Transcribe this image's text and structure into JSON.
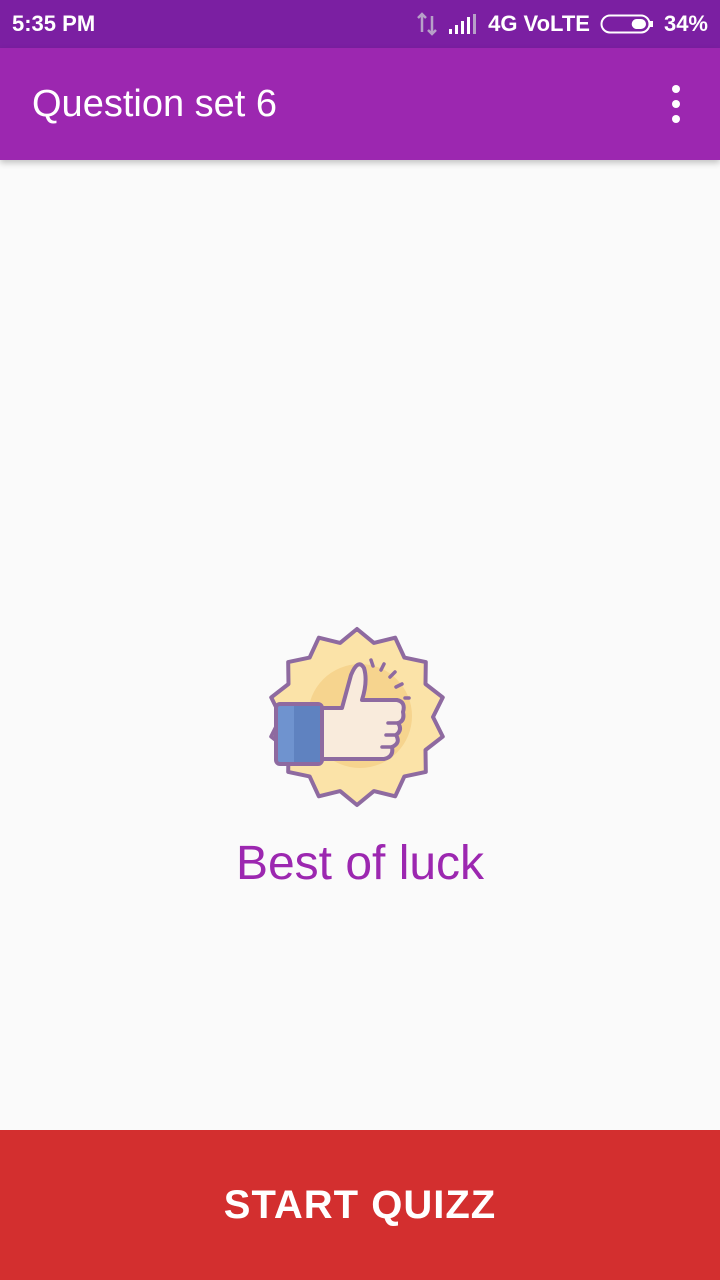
{
  "status_bar": {
    "time": "5:35 PM",
    "network": "4G VoLTE",
    "battery": "34%",
    "battery_level": 0.34,
    "icons": [
      "data-activity-icon",
      "signal-icon",
      "battery-icon"
    ]
  },
  "app_bar": {
    "title": "Question set 6",
    "menu_icon": "more-vert-icon"
  },
  "main": {
    "badge_icon": "thumbs-up-badge-icon",
    "message": "Best of luck"
  },
  "footer": {
    "start_label": "START QUIZZ"
  },
  "colors": {
    "status_bar": "#7b1fa2",
    "primary": "#9c27b0",
    "accent_button": "#d32f2f",
    "background": "#fafafa",
    "message_text": "#9c27b0"
  }
}
